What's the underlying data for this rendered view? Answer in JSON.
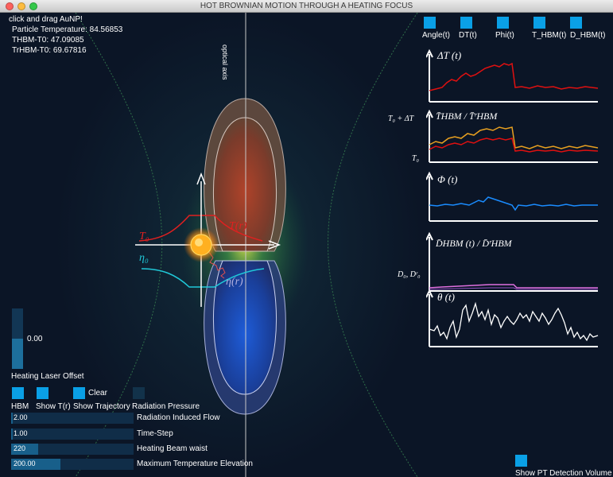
{
  "window": {
    "title": "HOT BROWNIAN MOTION THROUGH A HEATING FOCUS"
  },
  "info": {
    "hint": "click and drag AuNP!",
    "particle_temperature": "Particle Temperature: 84.56853",
    "thbm": "THBM-T0: 47.09085",
    "trhbm": "TrHBM-T0: 69.67816"
  },
  "axis_label": "optical axis",
  "diagram_labels": {
    "t0": "T₀",
    "tr": "T(r)",
    "eta0": "η₀",
    "etar": "η(r)"
  },
  "plot_toggles": [
    "Angle(t)",
    "DT(t)",
    "Phi(t)",
    "T_HBM(t)",
    "D_HBM(t)"
  ],
  "plots": [
    {
      "title": "ΔT (t)",
      "left_labels": []
    },
    {
      "title": "T̄HBM / T̄ʳHBM",
      "left_labels": [
        "T₀ + ΔT",
        "T₀"
      ]
    },
    {
      "title": "Φ (t)",
      "left_labels": []
    },
    {
      "title": "D̄HBM (t) / D̄ʳHBM",
      "left_labels": [
        "D₀, Dʳ₀"
      ]
    },
    {
      "title": "θ (t)",
      "left_labels": []
    }
  ],
  "laser_offset": {
    "value": "0.00",
    "label": "Heating Laser Offset",
    "fraction": 0.5
  },
  "checkboxes": {
    "hbm": "HBM",
    "show_tr": "Show T(r)",
    "show_trajectory": "Show Trajectory",
    "clear": "Clear",
    "radiation_pressure": "Radiation Pressure"
  },
  "sliders": [
    {
      "value": "2.00",
      "label": "Radiation Induced Flow",
      "fraction": 0.01
    },
    {
      "value": "1.00",
      "label": "Time-Step",
      "fraction": 0.01
    },
    {
      "value": "220",
      "label": "Heating Beam waist",
      "fraction": 0.22
    },
    {
      "value": "200.00",
      "label": "Maximum Temperature Elevation",
      "fraction": 0.4
    }
  ],
  "pt_detection": {
    "label": "Show PT Detection Volume"
  },
  "colors": {
    "toggle_on": "#0aa0e6",
    "toggle_off": "#12324a",
    "delta_t": "#e01010",
    "t_hbm": "#e8a020",
    "phi": "#1a8cff",
    "d_hbm": "#e070e0",
    "theta": "#ffffff"
  }
}
